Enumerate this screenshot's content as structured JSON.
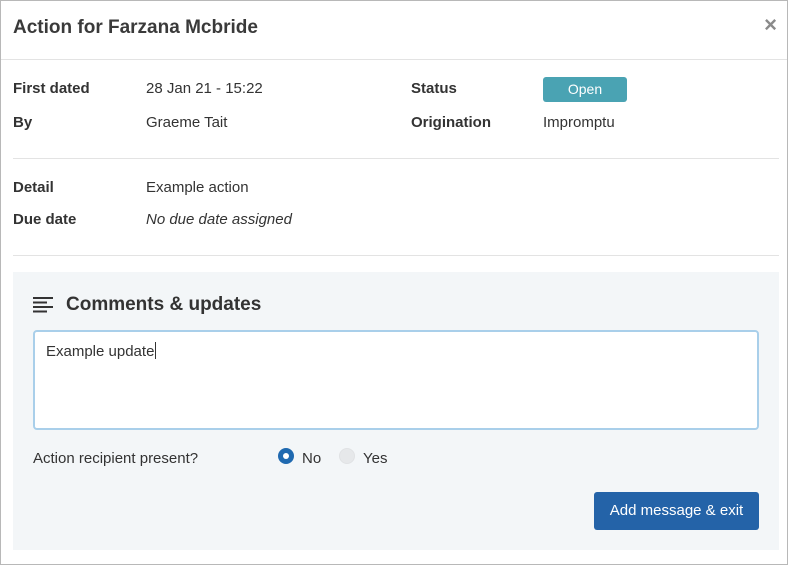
{
  "modal": {
    "title": "Action for Farzana Mcbride",
    "close_glyph": "×"
  },
  "details": {
    "first_dated_label": "First dated",
    "first_dated_value": "28 Jan 21 - 15:22",
    "by_label": "By",
    "by_value": "Graeme Tait",
    "status_label": "Status",
    "status_value": "Open",
    "origination_label": "Origination",
    "origination_value": "Impromptu",
    "detail_label": "Detail",
    "detail_value": "Example action",
    "due_date_label": "Due date",
    "due_date_value": "No due date assigned"
  },
  "comments": {
    "heading": "Comments & updates",
    "icon": "text-align-left-icon",
    "textarea_value": "Example update",
    "recipient_label": "Action recipient present?",
    "options": [
      "No",
      "Yes"
    ],
    "selected": "No",
    "submit_label": "Add message & exit"
  },
  "colors": {
    "status_badge": "#4aa3b3",
    "primary_button": "#2463a8",
    "radio_selected": "#1f69b0",
    "panel_bg": "#f3f6f8"
  }
}
